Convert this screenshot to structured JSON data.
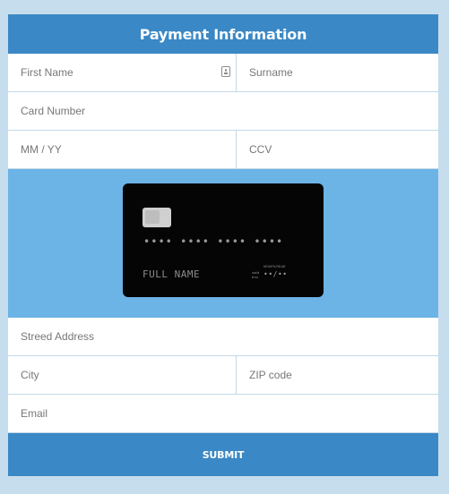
{
  "header": {
    "title": "Payment Information"
  },
  "fields": {
    "first_name": {
      "placeholder": "First Name",
      "value": ""
    },
    "surname": {
      "placeholder": "Surname",
      "value": ""
    },
    "card_number": {
      "placeholder": "Card Number",
      "value": ""
    },
    "expiry": {
      "placeholder": "MM / YY",
      "value": ""
    },
    "ccv": {
      "placeholder": "CCV",
      "value": ""
    },
    "street_address": {
      "placeholder": "Streed Address",
      "value": ""
    },
    "city": {
      "placeholder": "City",
      "value": ""
    },
    "zip": {
      "placeholder": "ZIP code",
      "value": ""
    },
    "email": {
      "placeholder": "Email",
      "value": ""
    }
  },
  "card_preview": {
    "number": "•••• •••• •••• ••••",
    "name": "FULL NAME",
    "valid_thru": "valid thru",
    "month_year_label": "MONTH/YEAR",
    "expiry": "••/••"
  },
  "submit": {
    "label": "SUBMIT"
  },
  "colors": {
    "background": "#c6ddee",
    "header": "#3a88c5",
    "card_area": "#6cb3e6",
    "card": "#050505",
    "border": "#c3d9e8"
  },
  "icons": {
    "autofill": "contact-card-icon"
  }
}
